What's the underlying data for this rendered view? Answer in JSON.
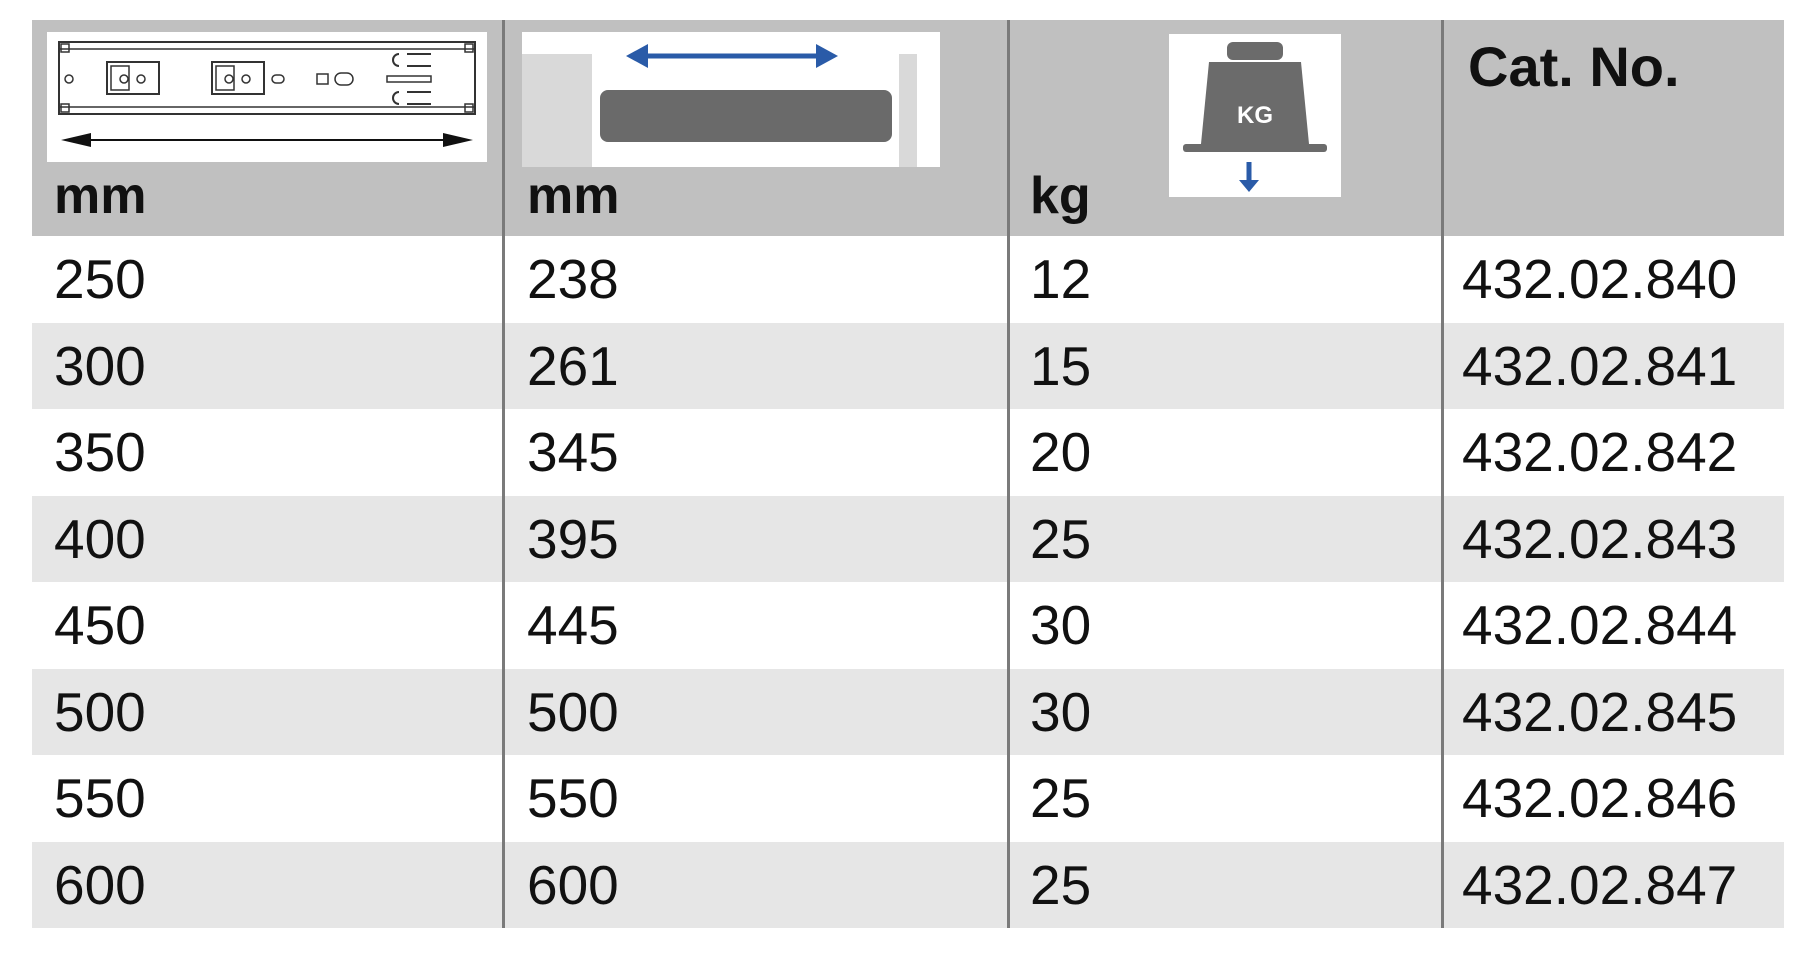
{
  "columns": [
    {
      "unit": "mm",
      "icon": "drawer-slide-length-icon"
    },
    {
      "unit": "mm",
      "icon": "extension-travel-icon"
    },
    {
      "unit": "kg",
      "icon": "load-capacity-weight-icon",
      "icon_text": "KG"
    },
    {
      "label": "Cat. No."
    }
  ],
  "rows": [
    [
      "250",
      "238",
      "12",
      "432.02.840"
    ],
    [
      "300",
      "261",
      "15",
      "432.02.841"
    ],
    [
      "350",
      "345",
      "20",
      "432.02.842"
    ],
    [
      "400",
      "395",
      "25",
      "432.02.843"
    ],
    [
      "450",
      "445",
      "30",
      "432.02.844"
    ],
    [
      "500",
      "500",
      "30",
      "432.02.845"
    ],
    [
      "550",
      "550",
      "25",
      "432.02.846"
    ],
    [
      "600",
      "600",
      "25",
      "432.02.847"
    ]
  ],
  "colors": {
    "header_bg": "#c0c0c0",
    "alt_row_bg": "#e6e6e6",
    "arrow_blue": "#2a5ba8",
    "weight_gray": "#6b6b6b"
  }
}
